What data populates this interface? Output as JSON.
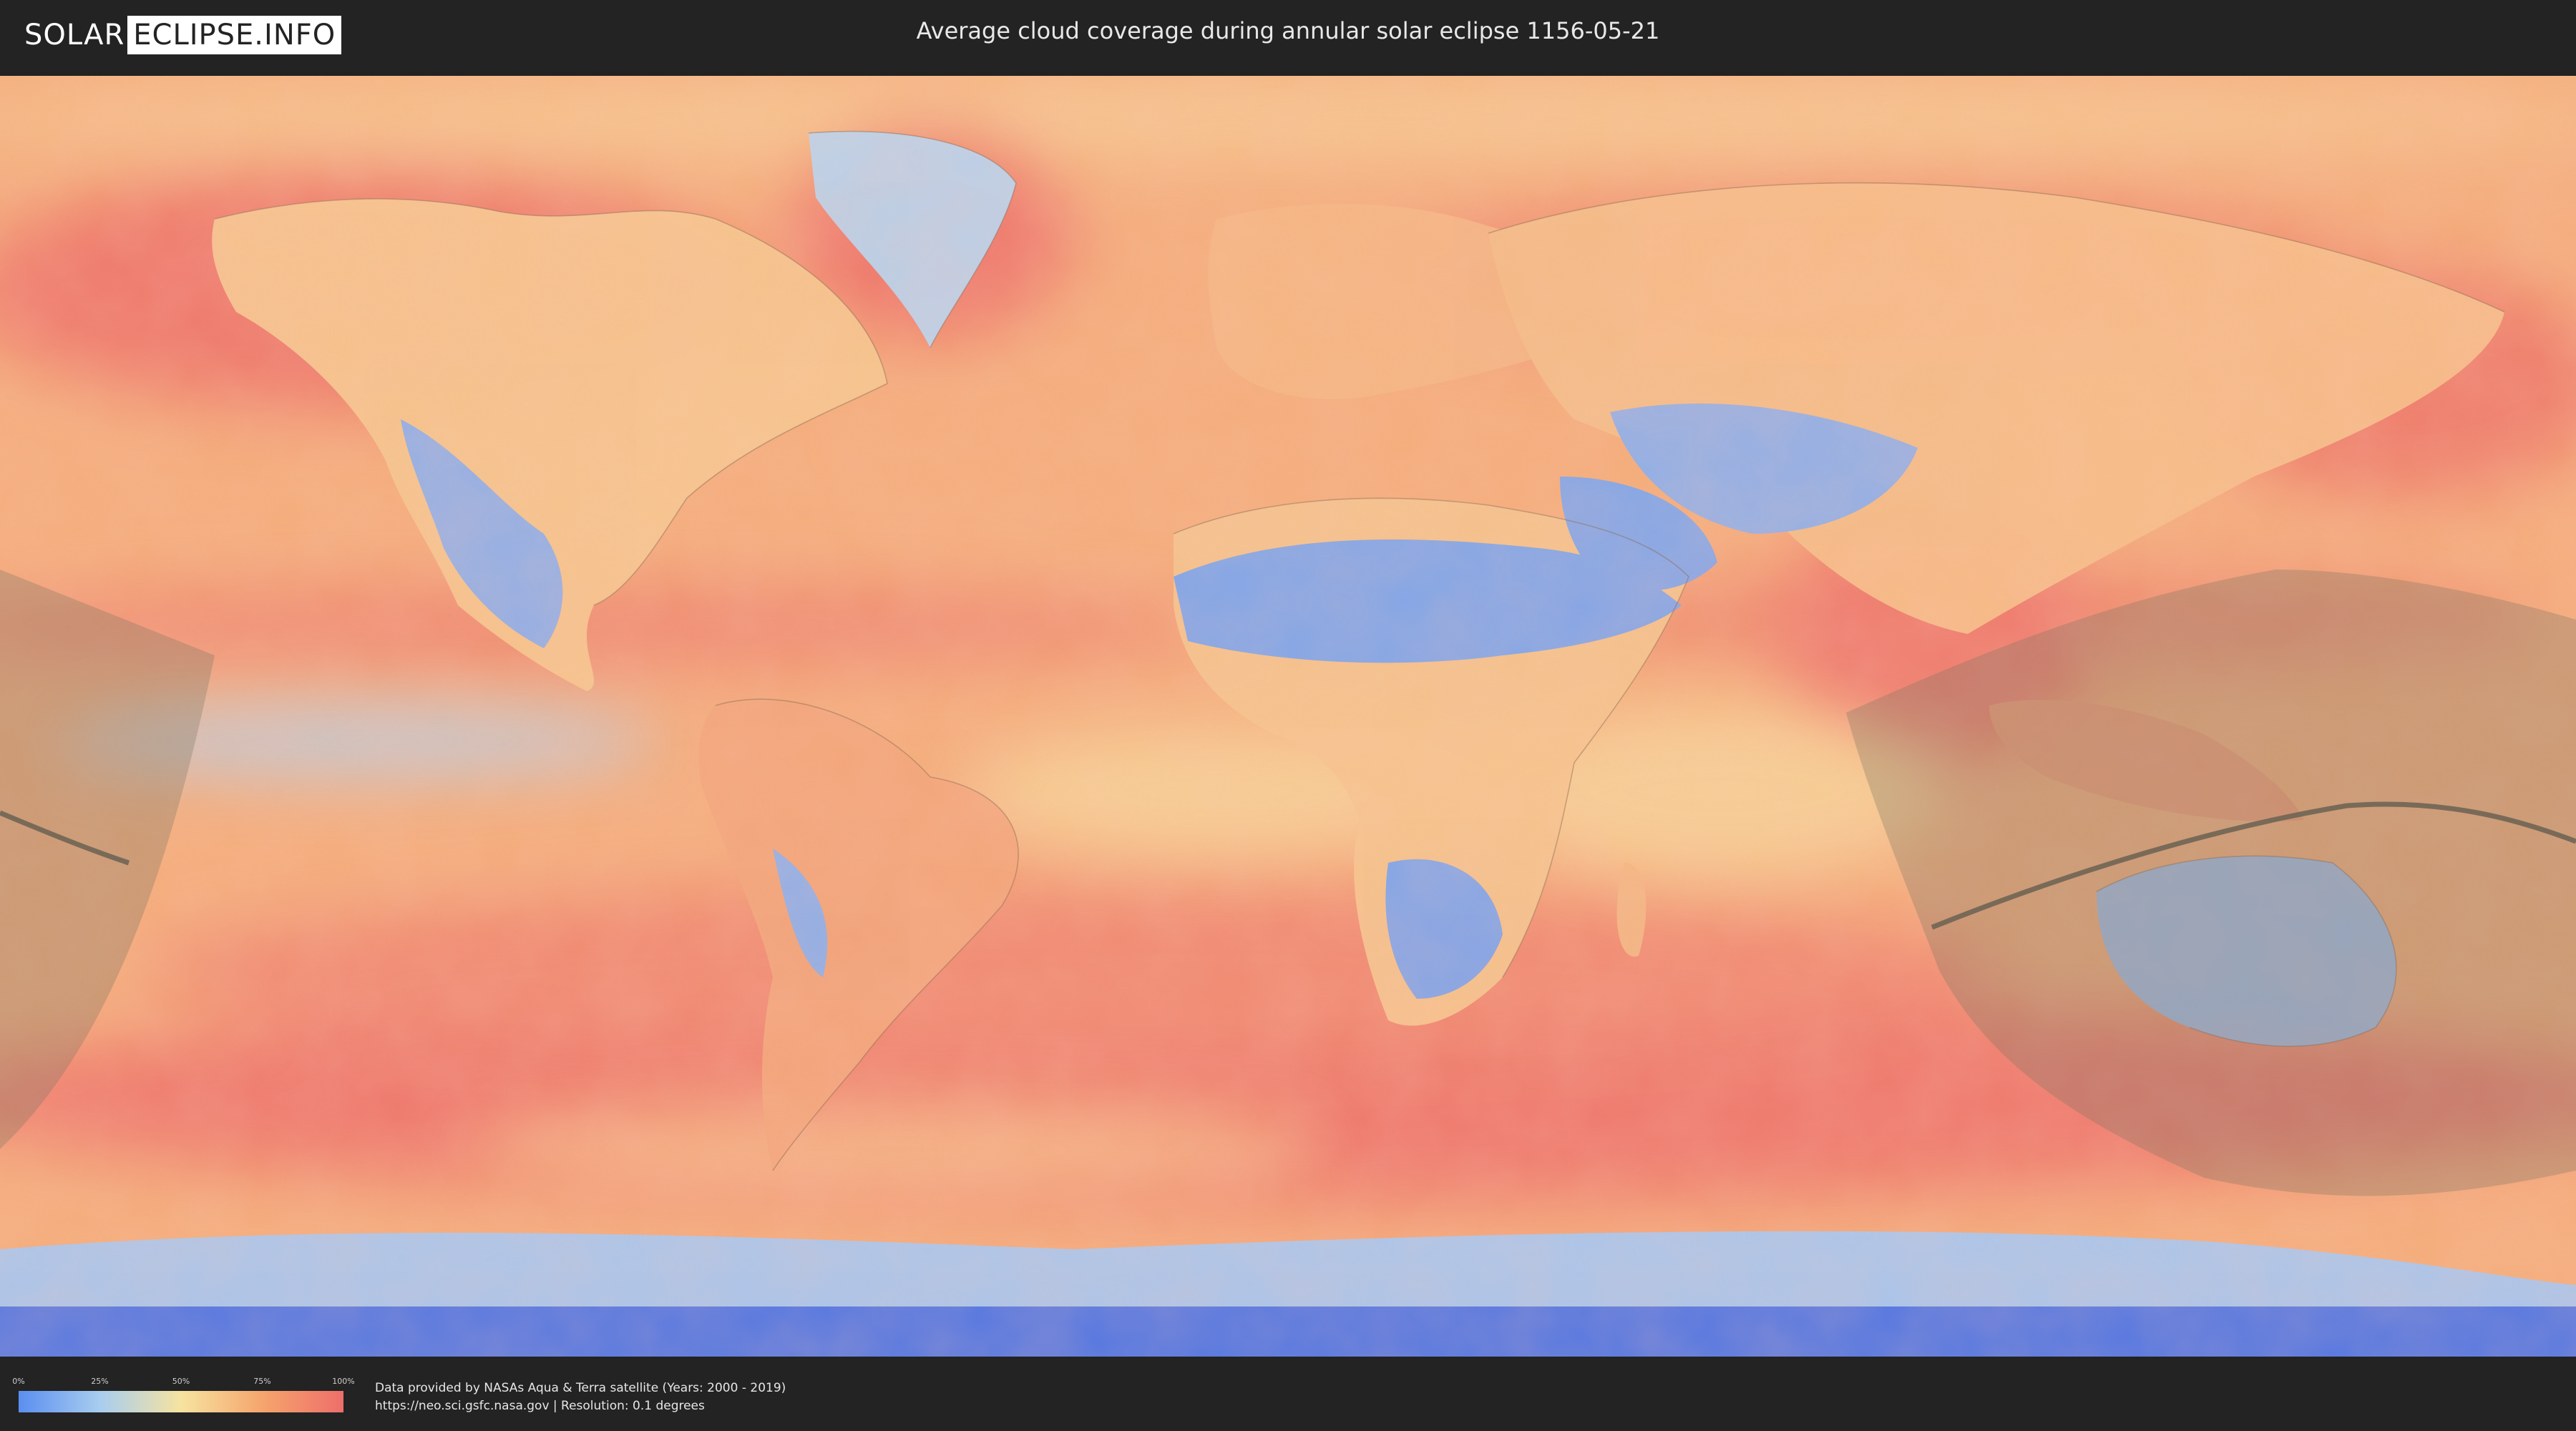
{
  "header": {
    "logo_left": "SOLAR",
    "logo_right": "ECLIPSE.INFO",
    "title": "Average cloud coverage during annular solar eclipse 1156-05-21"
  },
  "legend": {
    "ticks": [
      "0%",
      "25%",
      "50%",
      "75%",
      "100%"
    ],
    "colors": [
      "#5b8ef0",
      "#a8cdef",
      "#f6e3a0",
      "#f5a56d",
      "#ee6e6a"
    ]
  },
  "footer": {
    "credit_line1": "Data provided by NASAs Aqua & Terra satellite (Years: 2000 - 2019)",
    "credit_line2": "https://neo.sci.gsfc.nasa.gov | Resolution: 0.1 degrees"
  },
  "map": {
    "projection": "equirectangular world map",
    "colors": {
      "ocean_cloudy": "#ef7f6e",
      "ocean_mid": "#f5aa78",
      "clear_sky": "#7fa6ec",
      "antarctic": "#4f76e6",
      "eclipse_shadow": "#8a7a60"
    }
  }
}
